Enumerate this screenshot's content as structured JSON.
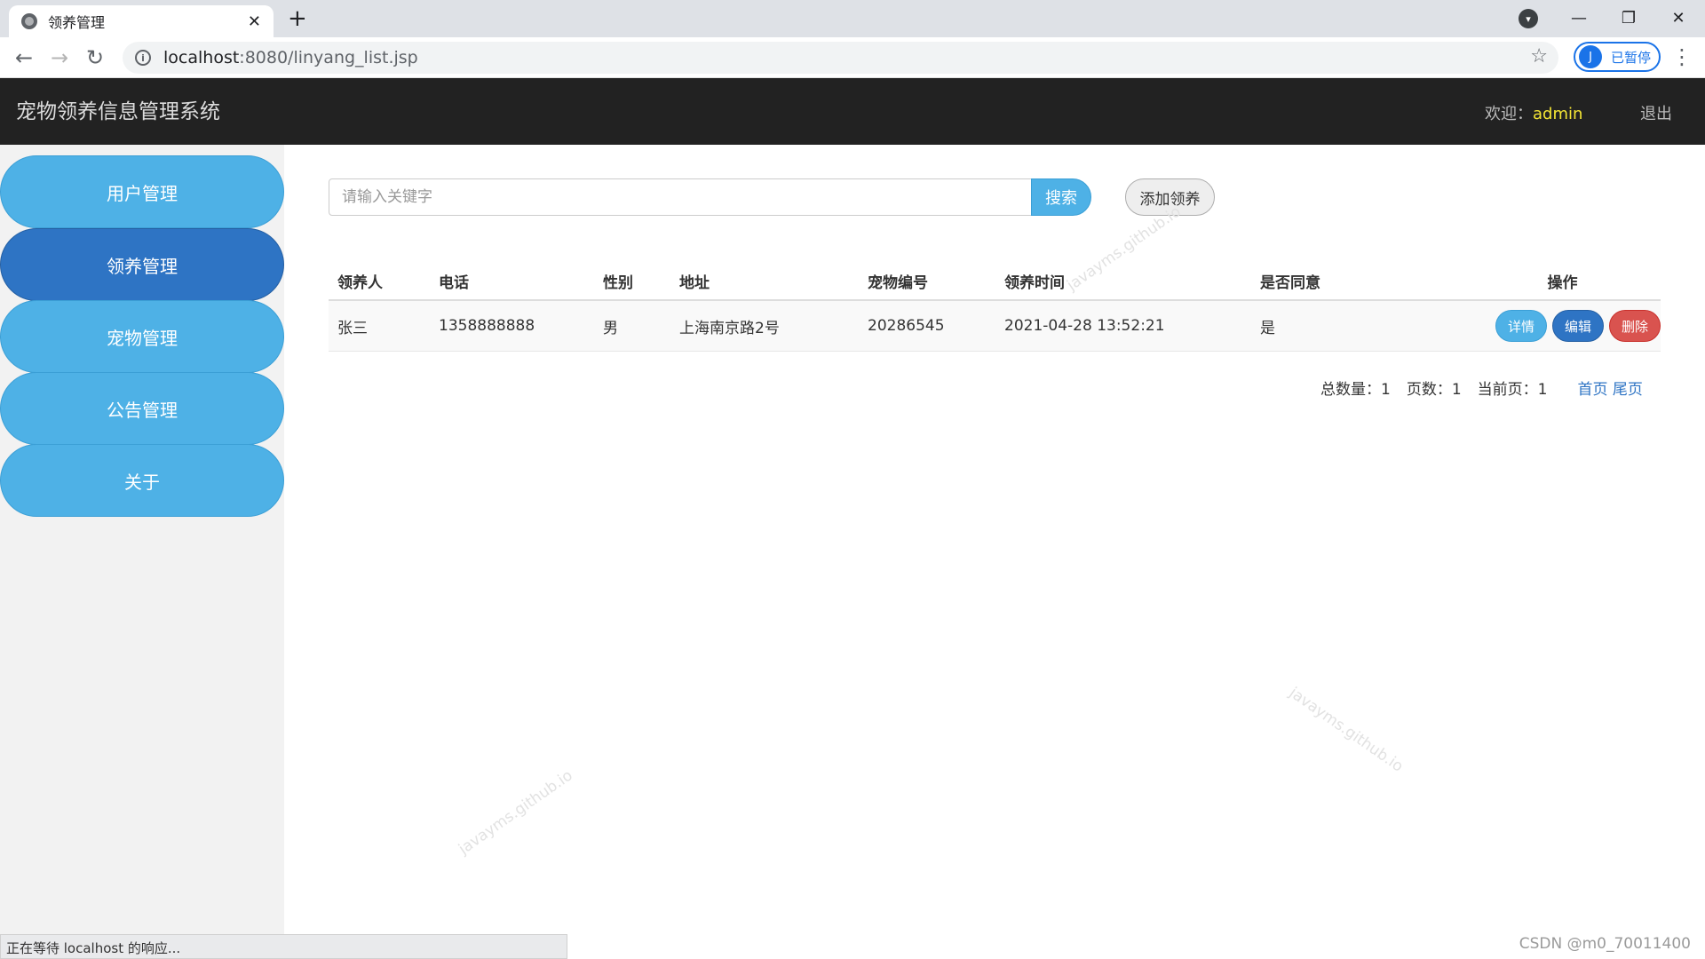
{
  "browser": {
    "tab_title": "领养管理",
    "url_host": "localhost",
    "url_rest": ":8080/linyang_list.jsp",
    "profile_label": "已暂停",
    "profile_initial": "J",
    "status_text": "正在等待 localhost 的响应..."
  },
  "app": {
    "title": "宠物领养信息管理系统",
    "welcome_label": "欢迎：",
    "username": "admin",
    "logout_label": "退出"
  },
  "sidebar": {
    "items": [
      {
        "label": "用户管理",
        "active": false
      },
      {
        "label": "领养管理",
        "active": true
      },
      {
        "label": "宠物管理",
        "active": false
      },
      {
        "label": "公告管理",
        "active": false
      },
      {
        "label": "关于",
        "active": false
      }
    ]
  },
  "search": {
    "placeholder": "请输入关键字",
    "value": "",
    "button_label": "搜索",
    "add_label": "添加领养"
  },
  "table": {
    "columns": [
      "领养人",
      "电话",
      "性别",
      "地址",
      "宠物编号",
      "领养时间",
      "是否同意",
      "操作"
    ],
    "rows": [
      {
        "adopter": "张三",
        "phone": "1358888888",
        "gender": "男",
        "address": "上海南京路2号",
        "pet_no": "20286545",
        "time": "2021-04-28 13:52:21",
        "agreed": "是",
        "actions": [
          "详情",
          "编辑",
          "删除"
        ]
      }
    ]
  },
  "pagination": {
    "total_label": "总数量：",
    "total": "1",
    "pages_label": "页数：",
    "pages": "1",
    "current_label": "当前页：",
    "current": "1",
    "first_label": "首页",
    "last_label": "尾页"
  },
  "watermarks": [
    "javayms.github.io",
    "javayms.github.io",
    "javayms.github.io"
  ],
  "footer_credit": "CSDN @m0_70011400",
  "colors": {
    "header_bg": "#222222",
    "sidebar_item": "#4eb1e6",
    "sidebar_active": "#2e74c4",
    "username": "#f5e634",
    "delete": "#d9534f"
  }
}
